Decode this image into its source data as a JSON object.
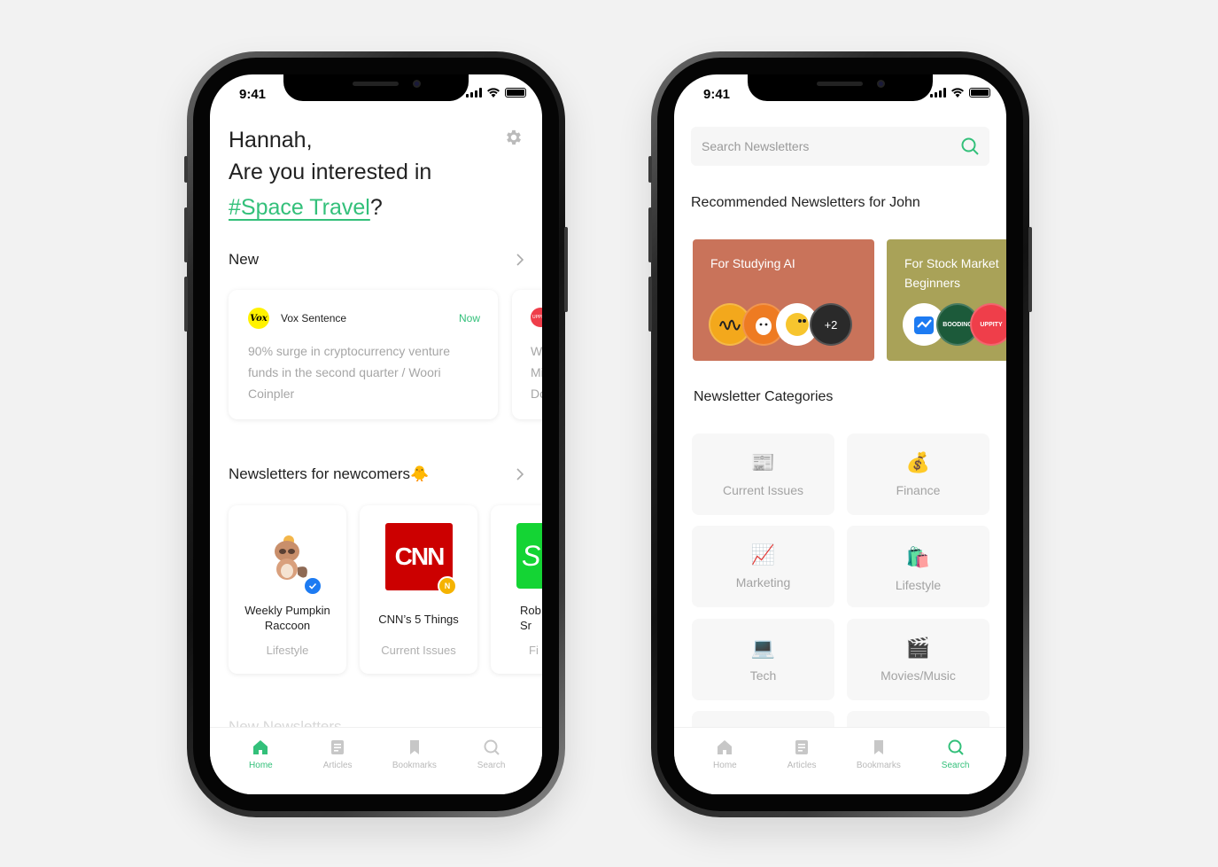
{
  "status": {
    "time": "9:41"
  },
  "home": {
    "greeting_name": "Hannah,",
    "greeting_question": "Are you interested in",
    "interest_tag": "#Space Travel",
    "interest_suffix": "?",
    "new_section": {
      "title": "New"
    },
    "new_cards": [
      {
        "source": "Vox Sentence",
        "logo_text": "Vox",
        "time": "Now",
        "body": "90% surge in cryptocurrency venture funds in the second quarter / Woori Coinpler"
      },
      {
        "logo_text": "UPPITY",
        "body_partial": "Wi\nMi\nDc"
      }
    ],
    "newcomers_section": {
      "title": "Newsletters for newcomers🐥"
    },
    "newcomer_cards": [
      {
        "name": "Weekly Pumpkin Raccoon",
        "category": "Lifestyle",
        "badge": "verified-check-badge"
      },
      {
        "name": "CNN’s 5 Things",
        "category": "Current Issues",
        "logo_text": "CNN",
        "badge_text": "N"
      },
      {
        "name_partial": "Rob\nSr",
        "category_partial": "Fi",
        "logo_text": "S"
      }
    ],
    "faded_section": "New Newsletters"
  },
  "search_page": {
    "search_placeholder": "Search Newsletters",
    "recommended_title": "Recommended Newsletters for John",
    "rec_cards": [
      {
        "title": "For Studying AI",
        "bg": "#c9735a",
        "more": "+2"
      },
      {
        "title": "For Stock Market Beginners",
        "bg": "#a9a258",
        "avatar_texts": [
          "BOODING",
          "UPPITY"
        ]
      }
    ],
    "categories_title": "Newsletter Categories",
    "categories": [
      {
        "label": "Current Issues",
        "emoji": "📰"
      },
      {
        "label": "Finance",
        "emoji": "💰"
      },
      {
        "label": "Marketing",
        "emoji": "📈"
      },
      {
        "label": "Lifestyle",
        "emoji": "🛍️"
      },
      {
        "label": "Tech",
        "emoji": "💻"
      },
      {
        "label": "Movies/Music",
        "emoji": "🎬"
      }
    ]
  },
  "tabs": [
    {
      "label": "Home",
      "icon": "home-icon"
    },
    {
      "label": "Articles",
      "icon": "articles-icon"
    },
    {
      "label": "Bookmarks",
      "icon": "bookmark-icon"
    },
    {
      "label": "Search",
      "icon": "search-icon"
    }
  ],
  "colors": {
    "accent": "#33c07a",
    "muted": "#b9b9b9"
  }
}
